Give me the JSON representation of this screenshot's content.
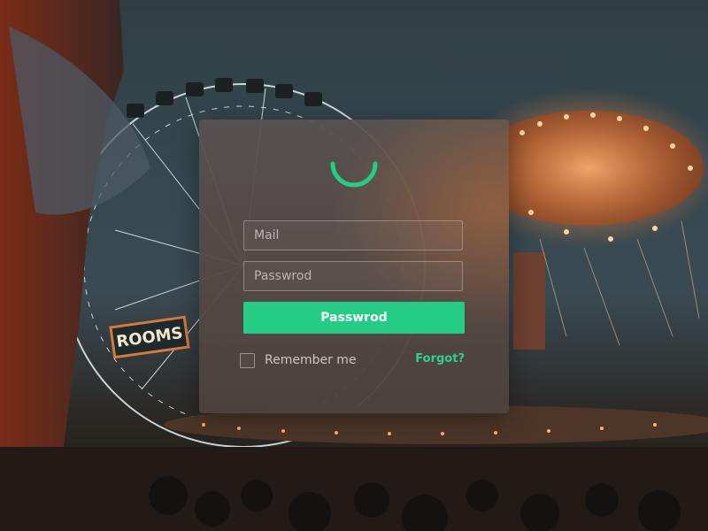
{
  "login": {
    "mail_placeholder": "Mail",
    "password_placeholder": "Passwrod",
    "submit_label": "Passwrod",
    "remember_label": "Remember me",
    "forgot_label": "Forgot?"
  },
  "background": {
    "sign_text": "ROOMS"
  },
  "colors": {
    "accent": "#24cc86",
    "card": "#56504e",
    "sky": "#34464e"
  },
  "icons": {
    "logo": "arc-logo-icon",
    "checkbox": "checkbox-icon"
  }
}
